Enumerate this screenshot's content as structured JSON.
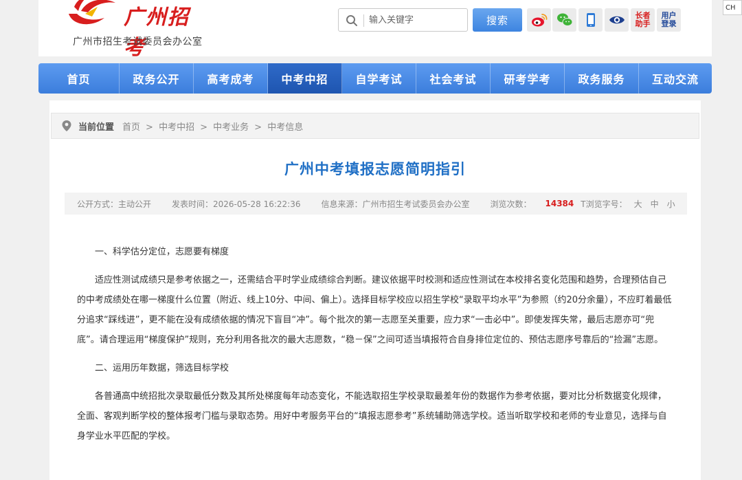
{
  "header": {
    "logo_calligraphy": "广州招考",
    "logo_subtitle": "广州市招生考试委员会办公室",
    "search_placeholder": "输入关键字",
    "search_button": "搜索",
    "icons": [
      {
        "name": "weibo-icon"
      },
      {
        "name": "wechat-icon"
      },
      {
        "name": "mobile-icon"
      },
      {
        "name": "eye-icon"
      },
      {
        "name": "elder-helper-icon",
        "label": "长者助手"
      },
      {
        "name": "user-login-icon",
        "label": "用户登录"
      }
    ]
  },
  "nav": {
    "items": [
      "首页",
      "政务公开",
      "高考成考",
      "中考中招",
      "自学考试",
      "社会考试",
      "研考学考",
      "政务服务",
      "互动交流"
    ],
    "active": "中考中招"
  },
  "breadcrumb": {
    "current_label": "当前位置",
    "path": [
      "首页",
      "中考中招",
      "中考业务",
      "中考信息"
    ]
  },
  "article": {
    "title": "广州中考填报志愿简明指引",
    "meta": {
      "mode": "公开方式：主动公开",
      "date": "发表时间：2026-05-28 16:22:36",
      "source": "信息来源：广州市招生考试委员会办公室",
      "views_label": "浏览次数：",
      "views_count": "14384",
      "font_label": "T浏览字号：",
      "font_sizes": [
        "大",
        "中",
        "小"
      ]
    },
    "paragraphs": [
      "一、科学估分定位，志愿要有梯度",
      "适应性测试成绩只是参考依据之一，还需结合平时学业成绩综合判断。建议依据平时校测和适应性测试在本校排名变化范围和趋势，合理预估自己的中考成绩处在哪一梯度什么位置（附近、线上10分、中间、偏上）。选择目标学校应以招生学校“录取平均水平”为参照（约20分余量），不应盯着最低分追求“踩线进”，更不能在没有成绩依据的情况下盲目“冲”。每个批次的第一志愿至关重要，应力求“一击必中”。即使发挥失常，最后志愿亦可“兜底”。请合理运用“梯度保护”规则，充分利用各批次的最大志愿数，“稳－保”之间可适当填报符合自身排位定位的、预估志愿序号靠后的“捡漏”志愿。",
      "二、运用历年数据，筛选目标学校",
      "各普通高中统招批次录取最低分数及其所处梯度每年动态变化，不能选取招生学校录取最差年份的数据作为参考依据，要对比分析数据变化规律，全面、客观判断学校的整体报考门槛与录取态势。用好中考服务平台的“填报志愿参考”系统辅助筛选学校。适当听取学校和老师的专业意见，选择与自身学业水平匹配的学校。"
    ]
  },
  "corner_tab": "CH",
  "colors": {
    "nav_blue": "#3b7ddc",
    "nav_active": "#1e55b0",
    "title_blue": "#1f6fc5",
    "accent_red": "#d81e1e"
  }
}
